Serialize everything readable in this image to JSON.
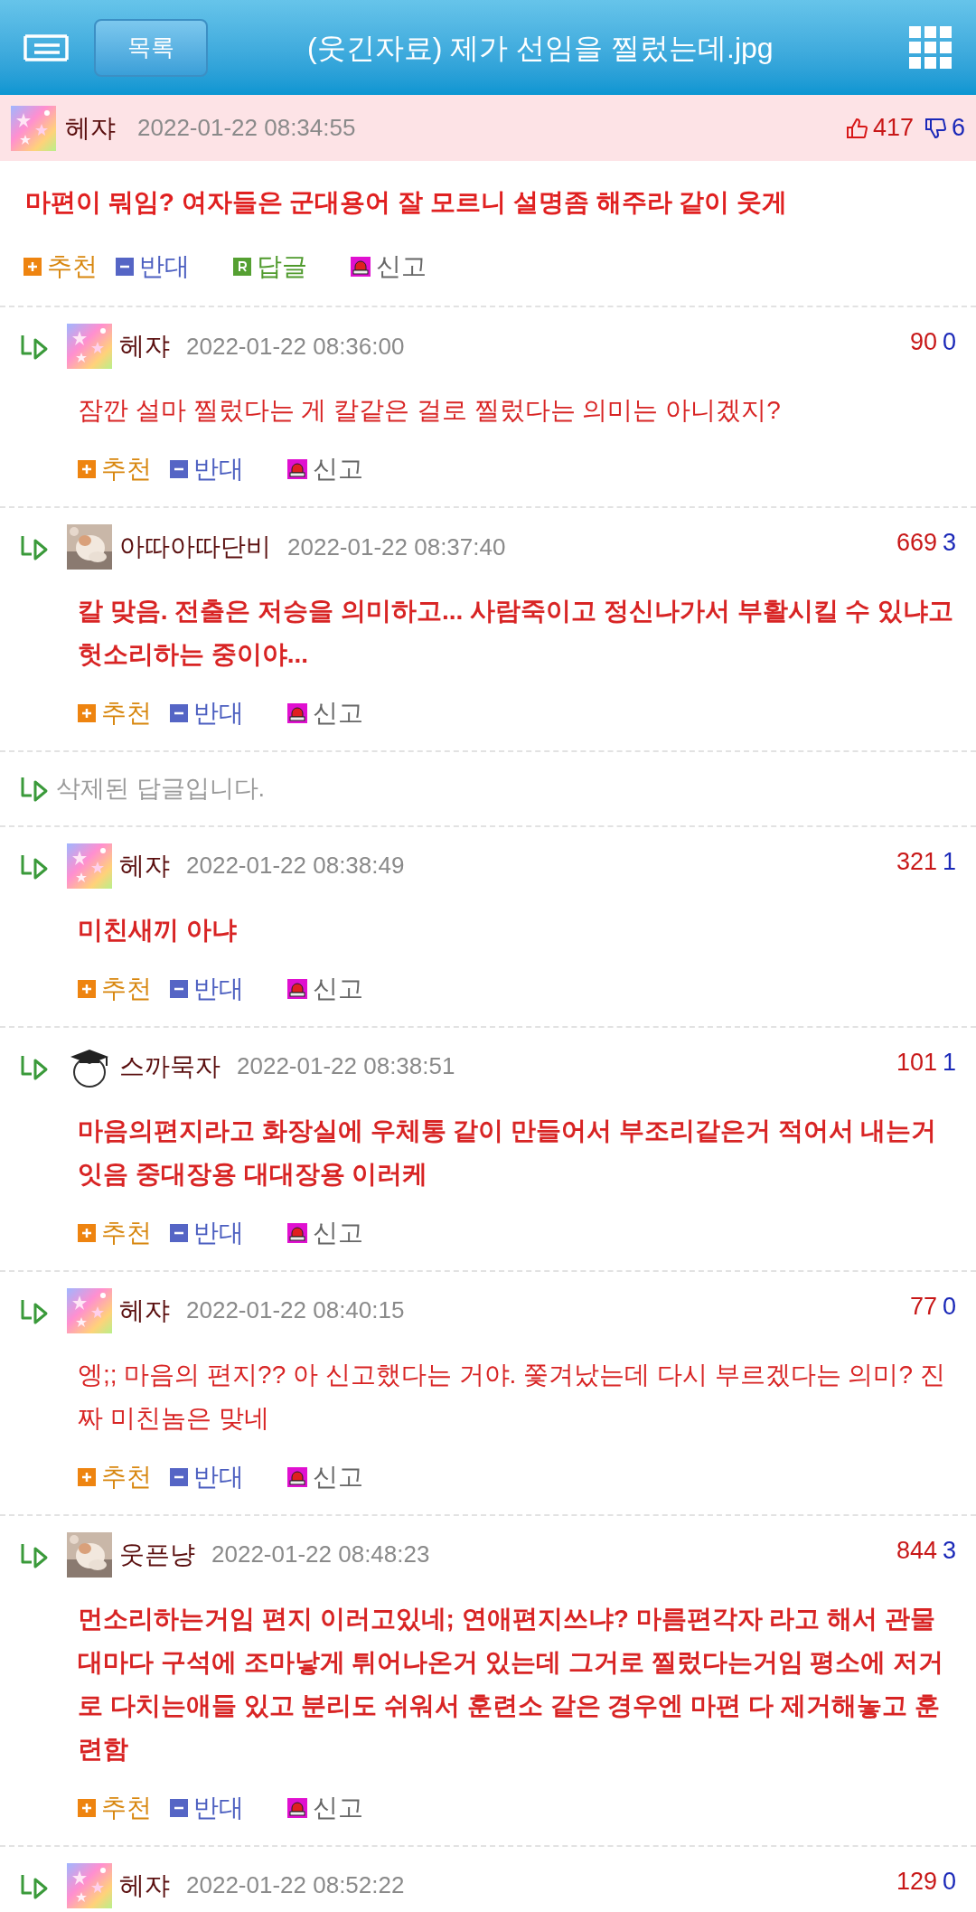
{
  "header": {
    "list_button": "목록",
    "title": "(웃긴자료) 제가 선임을 찔렀는데.jpg"
  },
  "post_comment": {
    "avatar": {
      "kind": "stars"
    },
    "author": "헤쟈",
    "date": "2022-01-22 08:34:55",
    "likes": "417",
    "dislikes": "6",
    "text": "마편이 뭐임? 여자들은 군대용어 잘 모르니 설명좀 해주라 같이 웃게",
    "bold": true,
    "actions": [
      {
        "kind": "up",
        "label": "추천"
      },
      {
        "kind": "down",
        "label": "반대"
      },
      {
        "kind": "reply",
        "label": "답글"
      },
      {
        "kind": "report",
        "label": "신고"
      }
    ]
  },
  "replies": [
    {
      "kind": "comment",
      "avatar": {
        "kind": "stars"
      },
      "author": "헤쟈",
      "date": "2022-01-22 08:36:00",
      "likes": "90",
      "dislikes": "0",
      "text": "잠깐 설마 찔렀다는 게 칼같은 걸로 찔렀다는 의미는 아니겠지?",
      "bold": false,
      "actions": [
        {
          "kind": "up",
          "label": "추천"
        },
        {
          "kind": "down",
          "label": "반대"
        },
        {
          "kind": "report",
          "label": "신고"
        }
      ]
    },
    {
      "kind": "comment",
      "avatar": {
        "kind": "picture"
      },
      "author": "아따아따단비",
      "date": "2022-01-22 08:37:40",
      "likes": "669",
      "dislikes": "3",
      "text": "칼 맞음. 전출은 저승을 의미하고... 사람죽이고 정신나가서 부활시킬 수 있냐고 헛소리하는 중이야...",
      "bold": true,
      "actions": [
        {
          "kind": "up",
          "label": "추천"
        },
        {
          "kind": "down",
          "label": "반대"
        },
        {
          "kind": "report",
          "label": "신고"
        }
      ]
    },
    {
      "kind": "deleted",
      "text": "삭제된 답글입니다."
    },
    {
      "kind": "comment",
      "avatar": {
        "kind": "stars"
      },
      "author": "헤쟈",
      "date": "2022-01-22 08:38:49",
      "likes": "321",
      "dislikes": "1",
      "text": "미친새끼 아냐",
      "bold": true,
      "actions": [
        {
          "kind": "up",
          "label": "추천"
        },
        {
          "kind": "down",
          "label": "반대"
        },
        {
          "kind": "report",
          "label": "신고"
        }
      ]
    },
    {
      "kind": "comment",
      "avatar": {
        "kind": "cap"
      },
      "author": "스까묵자",
      "date": "2022-01-22 08:38:51",
      "likes": "101",
      "dislikes": "1",
      "text": "마음의편지라고 화장실에 우체통 같이 만들어서 부조리같은거 적어서 내는거 잇음 중대장용 대대장용 이러케",
      "bold": true,
      "actions": [
        {
          "kind": "up",
          "label": "추천"
        },
        {
          "kind": "down",
          "label": "반대"
        },
        {
          "kind": "report",
          "label": "신고"
        }
      ]
    },
    {
      "kind": "comment",
      "avatar": {
        "kind": "stars"
      },
      "author": "헤쟈",
      "date": "2022-01-22 08:40:15",
      "likes": "77",
      "dislikes": "0",
      "text": "엥;; 마음의 편지?? 아 신고했다는 거야. 쫓겨났는데 다시 부르겠다는 의미? 진짜 미친놈은 맞네",
      "bold": false,
      "actions": [
        {
          "kind": "up",
          "label": "추천"
        },
        {
          "kind": "down",
          "label": "반대"
        },
        {
          "kind": "report",
          "label": "신고"
        }
      ]
    },
    {
      "kind": "comment",
      "avatar": {
        "kind": "picture"
      },
      "author": "웃픈냥",
      "date": "2022-01-22 08:48:23",
      "likes": "844",
      "dislikes": "3",
      "text": "먼소리하는거임 편지 이러고있네; 연애편지쓰냐? 마름편각자 라고 해서 관물대마다 구석에 조마낳게 튀어나온거 있는데 그거로 찔렀다는거임 평소에 저거로 다치는애들 있고 분리도 쉬워서 훈련소 같은 경우엔 마편 다 제거해놓고 훈련함",
      "bold": true,
      "actions": [
        {
          "kind": "up",
          "label": "추천"
        },
        {
          "kind": "down",
          "label": "반대"
        },
        {
          "kind": "report",
          "label": "신고"
        }
      ]
    },
    {
      "kind": "comment",
      "avatar": {
        "kind": "stars"
      },
      "author": "헤쟈",
      "date": "2022-01-22 08:52:22",
      "likes": "129",
      "dislikes": "0"
    }
  ]
}
